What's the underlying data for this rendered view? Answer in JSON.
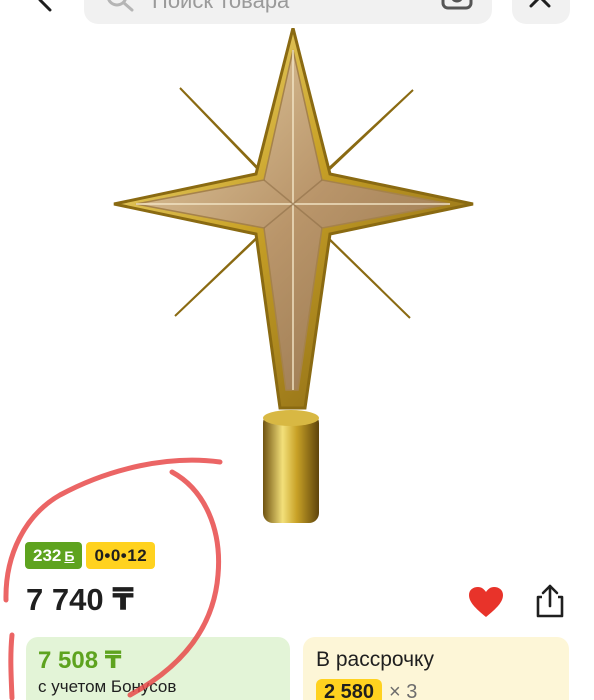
{
  "search": {
    "placeholder": "Поиск товара",
    "back_icon": "chevron-left-icon",
    "search_icon": "magnifier-icon",
    "camera_icon": "camera-icon",
    "close_icon": "close-icon"
  },
  "product": {
    "image_subject": "gold star tree topper",
    "bonus_badge": "232",
    "bonus_currency": "Б",
    "installment_badge": "0•0•12",
    "price": "7 740 ₸",
    "favorite_icon": "heart-icon",
    "share_icon": "share-icon"
  },
  "bonus_card": {
    "price": "7 508 ₸",
    "caption": "с учетом Бонусов"
  },
  "installment_card": {
    "title": "В рассрочку",
    "amount": "2 580",
    "multiplier": "× 3"
  },
  "colors": {
    "accent_green": "#5ea31f",
    "accent_yellow": "#ffd21f",
    "favorite_red": "#e8332a",
    "annotation_red": "#e84a4a"
  }
}
